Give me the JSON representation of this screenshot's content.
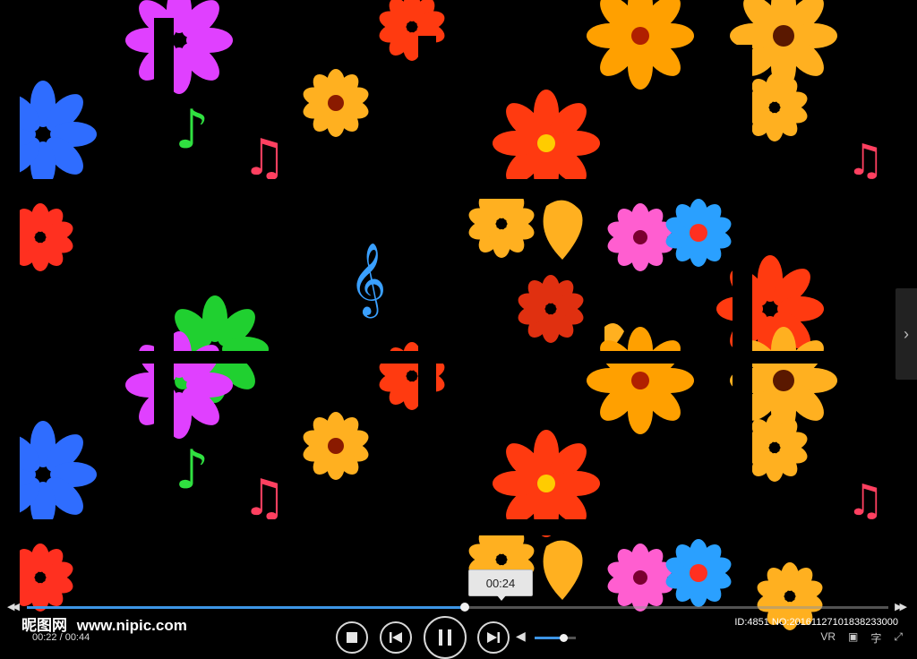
{
  "player": {
    "tooltip_time": "00:24",
    "time_display": "00:22 / 00:44",
    "progress_fraction": 0.508,
    "volume_fraction": 0.7,
    "accent_color": "#3d95e6"
  },
  "watermark": {
    "cn": "昵图网",
    "url": "www.nipic.com",
    "id_info": "ID:4851 NO:20161127101838233000"
  },
  "controls": {
    "seek_back": "◀◀",
    "seek_forward": "▶▶",
    "stop_icon": "stop-icon",
    "prev_icon": "prev-icon",
    "play_icon": "pause-icon",
    "next_icon": "next-icon",
    "volume_icon": "speaker-icon",
    "vr_label": "VR",
    "subtitle_label": "字"
  },
  "side_panel": {
    "chevron": "›"
  }
}
